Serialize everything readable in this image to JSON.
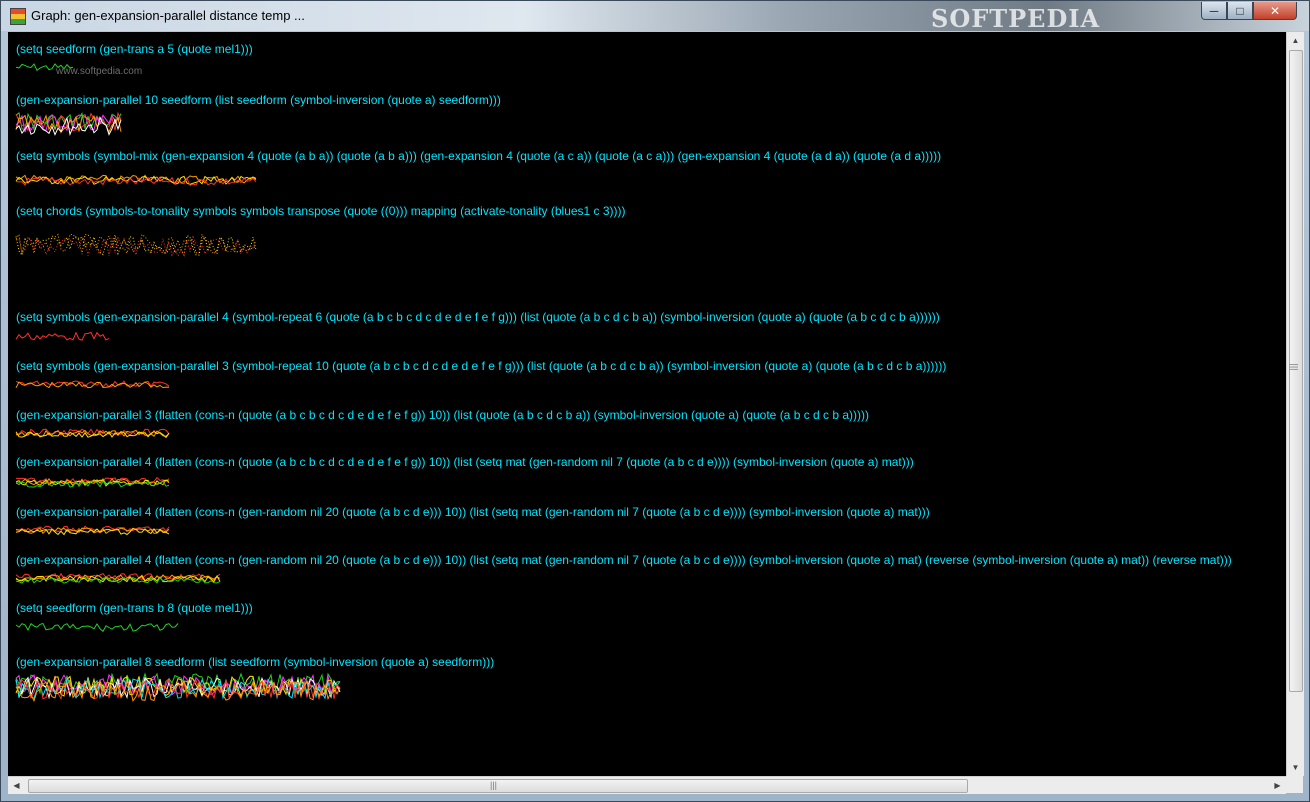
{
  "window": {
    "title": "Graph: gen-expansion-parallel distance temp ...",
    "brand": "SOFTPEDIA",
    "watermark": "www.softpedia.com",
    "controls": {
      "minimize": "─",
      "maximize": "□",
      "close": "✕"
    }
  },
  "expressions": [
    "(setq seedform (gen-trans a 5 (quote mel1)))",
    "(gen-expansion-parallel 10 seedform (list seedform (symbol-inversion (quote a) seedform)))",
    "(setq symbols (symbol-mix (gen-expansion 4 (quote (a b a)) (quote (a b a))) (gen-expansion 4 (quote (a c a)) (quote (a c a))) (gen-expansion 4 (quote (a d a)) (quote (a d a)))))",
    "(setq chords (symbols-to-tonality symbols symbols transpose (quote ((0))) mapping (activate-tonality (blues1 c 3))))",
    "(setq symbols (gen-expansion-parallel 4 (symbol-repeat 6 (quote (a b c b c d c d e d e f e f g))) (list (quote (a b c d c b a)) (symbol-inversion (quote a) (quote (a b c d c b a))))))",
    "(setq symbols (gen-expansion-parallel 3 (symbol-repeat 10 (quote (a b c b c d c d e d e f e f g))) (list (quote (a b c d c b a)) (symbol-inversion (quote a) (quote (a b c d c b a))))))",
    "(gen-expansion-parallel 3 (flatten (cons-n (quote (a b c b c d c d e d e f e f g)) 10)) (list (quote (a b c d c b a)) (symbol-inversion (quote a) (quote (a b c d c b a)))))",
    "(gen-expansion-parallel 4 (flatten (cons-n (quote (a b c b c d c d e d e f e f g)) 10)) (list (setq mat (gen-random nil 7 (quote (a b c d e)))) (symbol-inversion (quote a) mat)))",
    "(gen-expansion-parallel 4 (flatten (cons-n (gen-random nil 20 (quote (a b c d e))) 10)) (list (setq mat (gen-random nil 7 (quote (a b c d e)))) (symbol-inversion (quote a) mat)))",
    "(gen-expansion-parallel 4 (flatten (cons-n (gen-random nil 20 (quote (a b c d e))) 10)) (list (setq mat (gen-random nil 7 (quote (a b c d e)))) (symbol-inversion (quote a) mat) (reverse (symbol-inversion (quote a) mat)) (reverse mat)))",
    "(setq seedform (gen-trans b 8 (quote mel1)))",
    "(gen-expansion-parallel 8 seedform (list seedform (symbol-inversion (quote a) seedform)))"
  ],
  "graph_colors": {
    "green": "#1fd41f",
    "red": "#ff3030",
    "orange": "#ff9a00",
    "yellow": "#ffe000",
    "magenta": "#ff30ff",
    "cyan": "#00e5ff",
    "white": "#ffffff"
  },
  "scrollbars": {
    "up": "▲",
    "down": "▼",
    "left": "◀",
    "right": "▶",
    "grip": "|||"
  }
}
